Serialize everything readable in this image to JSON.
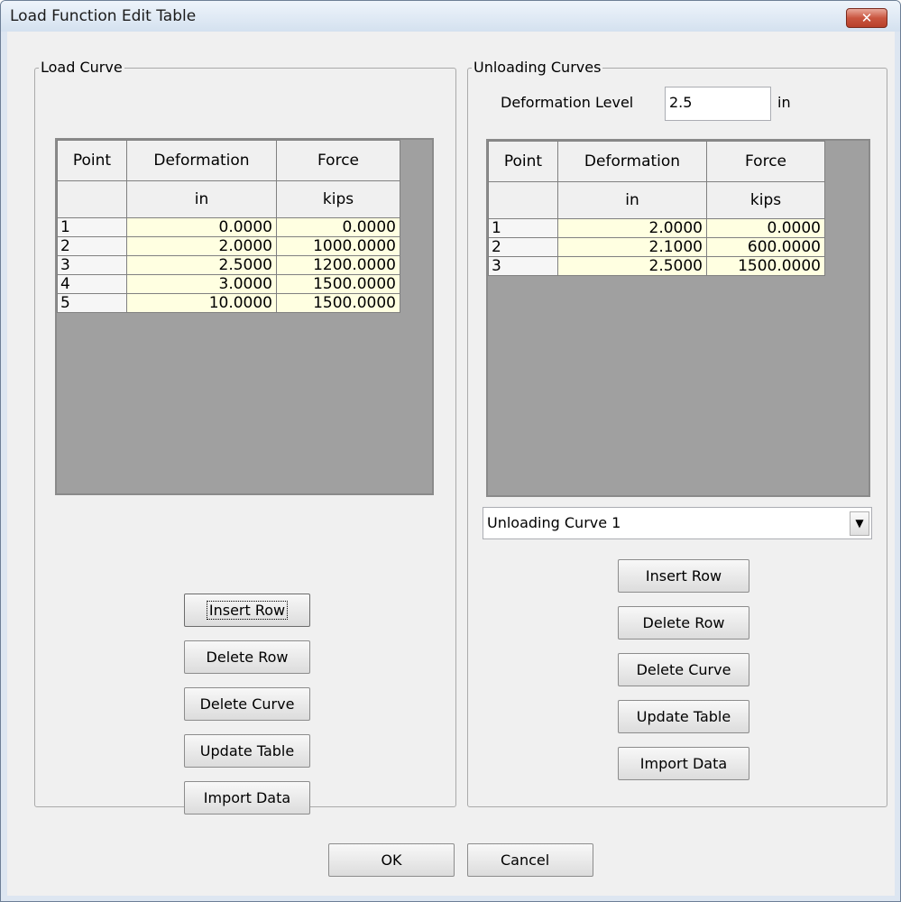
{
  "window": {
    "title": "Load Function Edit Table",
    "close_symbol": "✕"
  },
  "load_curve": {
    "legend": "Load Curve",
    "columns": [
      "Point",
      "Deformation",
      "Force"
    ],
    "units": [
      "",
      "in",
      "kips"
    ],
    "rows": [
      [
        "1",
        "0.0000",
        "0.0000"
      ],
      [
        "2",
        "2.0000",
        "1000.0000"
      ],
      [
        "3",
        "2.5000",
        "1200.0000"
      ],
      [
        "4",
        "3.0000",
        "1500.0000"
      ],
      [
        "5",
        "10.0000",
        "1500.0000"
      ]
    ],
    "buttons": {
      "insert_row": "Insert Row",
      "delete_row": "Delete Row",
      "delete_curve": "Delete Curve",
      "update_table": "Update Table",
      "import_data": "Import Data"
    }
  },
  "unloading_curves": {
    "legend": "Unloading Curves",
    "deformation_level_label": "Deformation Level",
    "deformation_level_value": "2.5",
    "deformation_level_unit": "in",
    "columns": [
      "Point",
      "Deformation",
      "Force"
    ],
    "units": [
      "",
      "in",
      "kips"
    ],
    "rows": [
      [
        "1",
        "2.0000",
        "0.0000"
      ],
      [
        "2",
        "2.1000",
        "600.0000"
      ],
      [
        "3",
        "2.5000",
        "1500.0000"
      ]
    ],
    "curve_select": {
      "selected": "Unloading Curve 1",
      "arrow": "▼"
    },
    "buttons": {
      "insert_row": "Insert Row",
      "delete_row": "Delete Row",
      "delete_curve": "Delete Curve",
      "update_table": "Update Table",
      "import_data": "Import Data"
    }
  },
  "footer": {
    "ok": "OK",
    "cancel": "Cancel"
  }
}
